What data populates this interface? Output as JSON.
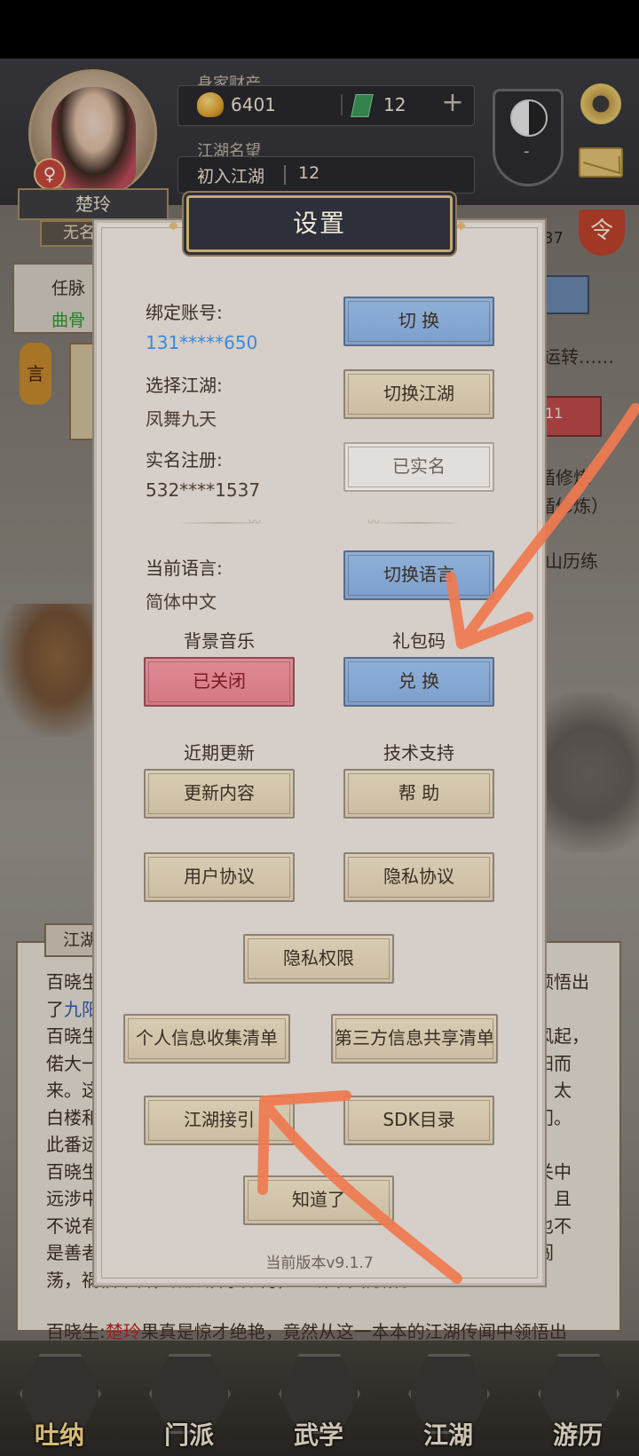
{
  "header": {
    "player_name": "楚玲",
    "player_rank": "无名",
    "wealth_label": "身家财产",
    "gold": "6401",
    "jade": "12",
    "fame_label": "江湖名望",
    "fame_title": "初入江湖",
    "fame_value": "12",
    "taiji_dash": "-",
    "ling": "令",
    "bg_number": "37"
  },
  "background": {
    "left_top": "任脉",
    "left_green": "曲骨",
    "lantern": "言",
    "right_1": "运转……",
    "right_2": "11",
    "right_3": "循修炼",
    "right_4": "循修炼）",
    "right_5": "山历练"
  },
  "log": {
    "tab": "江湖",
    "lines": [
      {
        "pre": "百晓生",
        "hl": "",
        "post": "",
        "tail": "顿悟出"
      },
      {
        "pre": "了",
        "blue": "九阳",
        "post": "",
        "tail": ""
      },
      {
        "pre": "百晓生",
        "post": "",
        "tail": "风起，"
      },
      {
        "pre": "偌大一",
        "post": "",
        "tail": "阳而"
      },
      {
        "pre": "来。这",
        "post": "",
        "tail": "，太"
      },
      {
        "pre": "白楼和",
        "post": "",
        "tail": "门。"
      },
      {
        "pre": "此番远",
        "post": "",
        "tail": ""
      },
      {
        "pre": "百晓生",
        "post": "",
        "tail": "关中"
      },
      {
        "pre": "远涉中",
        "post": "",
        "tail": "，且"
      },
      {
        "pre": "不说有",
        "post": "",
        "tail": "也不"
      },
      {
        "pre": "是善者",
        "post": "",
        "tail": "闯"
      },
      {
        "pre": "荡，祸福难料，欲知后事如何，且听下回分解。",
        "post": "",
        "tail": ""
      }
    ],
    "last_line_pre": "百晓生:",
    "last_line_name": "楚玲",
    "last_line_post": "果真是惊才绝艳，竟然从这一本本的江湖传闻中领悟出"
  },
  "nav": {
    "items": [
      {
        "label": "吐纳"
      },
      {
        "label": "门派"
      },
      {
        "label": "武学"
      },
      {
        "label": "江湖"
      },
      {
        "label": "游历"
      }
    ]
  },
  "settings": {
    "title": "设置",
    "bind_account_label": "绑定账号:",
    "bind_account_value": "131*****650",
    "switch_label": "切 换",
    "select_world_label": "选择江湖:",
    "select_world_value": "凤舞九天",
    "switch_world_label": "切换江湖",
    "realname_label": "实名注册:",
    "realname_value": "532****1537",
    "realname_btn": "已实名",
    "language_label": "当前语言:",
    "language_value": "简体中文",
    "switch_language_btn": "切换语言",
    "bgm_label": "背景音乐",
    "bgm_btn": "已关闭",
    "giftcode_label": "礼包码",
    "giftcode_btn": "兑 换",
    "updates_label": "近期更新",
    "updates_btn": "更新内容",
    "support_label": "技术支持",
    "help_btn": "帮 助",
    "user_agreement_btn": "用户协议",
    "privacy_agreement_btn": "隐私协议",
    "privacy_permission_btn": "隐私权限",
    "personal_info_btn": "个人信息收集清单",
    "third_party_btn": "第三方信息共享清单",
    "jianghu_guide_btn": "江湖接引",
    "sdk_btn": "SDK目录",
    "got_it_btn": "知道了",
    "version": "当前版本v9.1.7"
  },
  "colors": {
    "annotation": "#f07a50",
    "blue_button": "#8fb0d8",
    "red_button": "#df8a96",
    "tan_button": "#d8ccb4",
    "modal_bg": "#d6cec8",
    "title_bg": "#2d2f3a"
  },
  "icons": {
    "gold": "gold-ingot-icon",
    "jade": "jade-icon",
    "plus": "plus-icon",
    "taiji": "taiji-icon",
    "gear": "gear-icon",
    "mail": "mail-icon",
    "gender": "female-icon"
  }
}
